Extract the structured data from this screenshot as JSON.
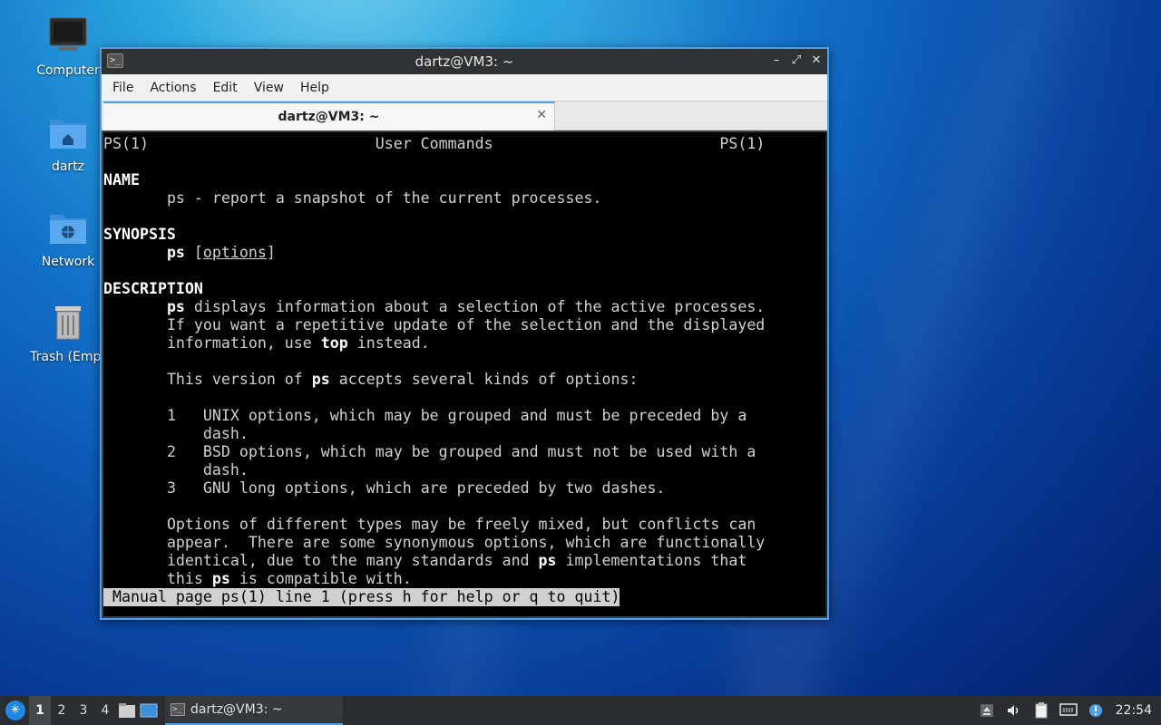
{
  "desktop": {
    "icons": [
      {
        "label": "Computer",
        "icon": "computer-icon"
      },
      {
        "label": "dartz",
        "icon": "home-folder-icon"
      },
      {
        "label": "Network",
        "icon": "network-folder-icon"
      },
      {
        "label": "Trash (Empt",
        "icon": "trash-icon"
      }
    ]
  },
  "window": {
    "title": "dartz@VM3: ~",
    "controls": {
      "minimize": "–",
      "maximize": "⤢",
      "close": "✕"
    },
    "menu": [
      "File",
      "Actions",
      "Edit",
      "View",
      "Help"
    ],
    "tab": {
      "title": "dartz@VM3: ~",
      "close": "✕"
    }
  },
  "terminal": {
    "header_left": "PS(1)",
    "header_center": "User Commands",
    "header_right": "PS(1)",
    "name_heading": "NAME",
    "name_text": "ps - report a snapshot of the current processes.",
    "synopsis_heading": "SYNOPSIS",
    "synopsis_cmd": "ps",
    "synopsis_options": "options",
    "description_heading": "DESCRIPTION",
    "desc_ps": "ps",
    "desc_line1": " displays information about a selection of the active processes.",
    "desc_line2": "If you want a repetitive update of the selection and the displayed",
    "desc_line3a": "information, use ",
    "desc_top": "top",
    "desc_line3b": " instead.",
    "version_a": "This version of ",
    "version_ps": "ps",
    "version_b": " accepts several kinds of options:",
    "opt1_num": "1",
    "opt1_line1": "UNIX options, which may be grouped and must be preceded by a",
    "opt1_line2": "dash.",
    "opt2_num": "2",
    "opt2_line1": "BSD options, which may be grouped and must not be used with a",
    "opt2_line2": "dash.",
    "opt3_num": "3",
    "opt3_line1": "GNU long options, which are preceded by two dashes.",
    "mix_line1": "Options of different types may be freely mixed, but conflicts can",
    "mix_line2": "appear.  There are some synonymous options, which are functionally",
    "mix_line3a": "identical, due to the many standards and ",
    "mix_ps": "ps",
    "mix_line3b": " implementations that",
    "mix_line4a": "this ",
    "mix_line4_ps": "ps",
    "mix_line4b": " is compatible with.",
    "status": " Manual page ps(1) line 1 (press h for help or q to quit)"
  },
  "taskbar": {
    "workspaces": [
      "1",
      "2",
      "3",
      "4"
    ],
    "active_workspace": "1",
    "task_label": "dartz@VM3: ~",
    "clock": "22:54"
  },
  "colors": {
    "accent": "#4f9ee8",
    "taskbar_bg": "#2b2e30",
    "terminal_bg": "#000000"
  }
}
